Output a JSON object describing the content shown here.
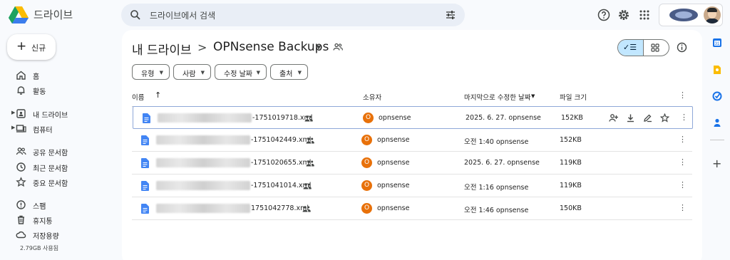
{
  "app": {
    "name": "드라이브"
  },
  "search": {
    "placeholder": "드라이브에서 검색"
  },
  "topbar": {
    "icons": [
      "help-icon",
      "settings-icon",
      "apps-icon"
    ]
  },
  "sidebar": {
    "new_label": "신규",
    "items": [
      {
        "label": "홈",
        "icon": "home-icon"
      },
      {
        "label": "활동",
        "icon": "bell-icon"
      },
      {
        "label": "내 드라이브",
        "icon": "my-drive-icon"
      },
      {
        "label": "컴퓨터",
        "icon": "computer-icon"
      },
      {
        "label": "공유 문서함",
        "icon": "people-icon"
      },
      {
        "label": "최근 문서함",
        "icon": "clock-icon"
      },
      {
        "label": "중요 문서함",
        "icon": "star-icon"
      },
      {
        "label": "스팸",
        "icon": "spam-icon"
      },
      {
        "label": "휴지통",
        "icon": "trash-icon"
      },
      {
        "label": "저장용량",
        "icon": "cloud-icon"
      }
    ],
    "storage_text": "2.79GB 사용됨"
  },
  "breadcrumb": {
    "root": "내 드라이브",
    "separator": ">",
    "current": "OPNsense Backups"
  },
  "filters": [
    "유형",
    "사람",
    "수정 날짜",
    "출처"
  ],
  "table": {
    "headers": {
      "name": "이름",
      "owner": "소유자",
      "modified": "마지막으로 수정한 날짜",
      "size": "파일 크기"
    },
    "rows": [
      {
        "name": "-1751019718.xml",
        "owner": "opnsense",
        "owner_initial": "O",
        "modified": "2025. 6. 27. opnsense",
        "size": "152KB",
        "selected": true
      },
      {
        "name": "-1751042449.xml",
        "owner": "opnsense",
        "owner_initial": "O",
        "modified": "오전 1:40 opnsense",
        "size": "152KB",
        "selected": false
      },
      {
        "name": "-1751020655.xml",
        "owner": "opnsense",
        "owner_initial": "O",
        "modified": "2025. 6. 27. opnsense",
        "size": "119KB",
        "selected": false
      },
      {
        "name": "-1751041014.xml",
        "owner": "opnsense",
        "owner_initial": "O",
        "modified": "오전 1:16 opnsense",
        "size": "119KB",
        "selected": false
      },
      {
        "name": "1751042778.xml",
        "owner": "opnsense",
        "owner_initial": "O",
        "modified": "오전 1:46 opnsense",
        "size": "150KB",
        "selected": false
      }
    ],
    "row_actions": [
      "share-icon",
      "download-icon",
      "rename-icon",
      "star-icon"
    ]
  },
  "colors": {
    "accent": "#0b57d0",
    "selected_bg": "#c2e7ff",
    "owner_avatar": "#e8710a",
    "page_bg": "#f8fafd"
  }
}
